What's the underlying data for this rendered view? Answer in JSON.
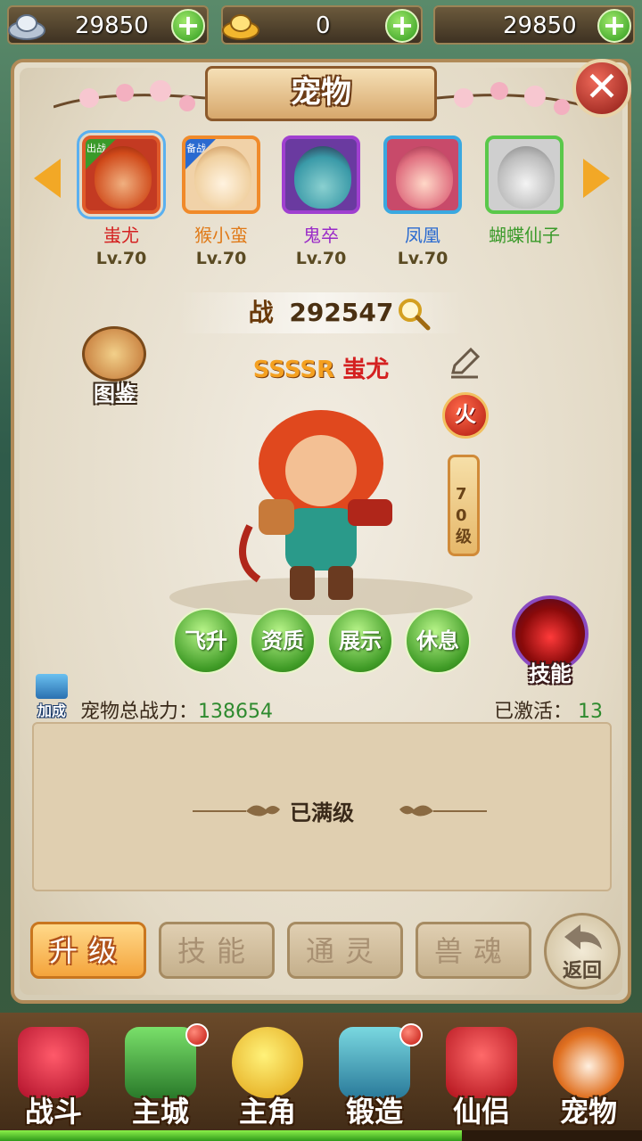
{
  "currency": [
    {
      "icon": "silver-ingot-icon",
      "value": "29850"
    },
    {
      "icon": "gold-ingot-icon",
      "value": "0"
    },
    {
      "icon": "",
      "value": "29850"
    }
  ],
  "window": {
    "title": "宠物"
  },
  "pets": [
    {
      "name": "蚩尤",
      "level": "Lv.70",
      "badge": "出战",
      "name_color": "#d42020",
      "frame_color": "#e05a2a",
      "selected": true
    },
    {
      "name": "猴小蛮",
      "level": "Lv.70",
      "badge": "备战",
      "name_color": "#e07a18",
      "frame_color": "#f08a2a"
    },
    {
      "name": "鬼卒",
      "level": "Lv.70",
      "badge": "",
      "name_color": "#9a2ac8",
      "frame_color": "#a040d0"
    },
    {
      "name": "凤凰",
      "level": "Lv.70",
      "badge": "",
      "name_color": "#2a6ad0",
      "frame_color": "#3aa8e0"
    },
    {
      "name": "蝴蝶仙子",
      "level": "",
      "badge": "",
      "name_color": "#3a9a2a",
      "frame_color": "#5ac84a"
    }
  ],
  "battle": {
    "label": "战",
    "value": "292547"
  },
  "pet_detail": {
    "rank": "SSSSR",
    "name": "蚩尤",
    "element": "火",
    "level_text": "70级",
    "codex_label": "图鉴",
    "skill_label": "技能"
  },
  "actions": [
    "飞升",
    "资质",
    "展示",
    "休息"
  ],
  "stats": {
    "bonus_label": "加成",
    "total_power_label": "宠物总战力：",
    "total_power_value": "138654",
    "activated_label": "已激活：",
    "activated_value": "13"
  },
  "info": {
    "text": "已满级"
  },
  "tabs": [
    {
      "label": "升级",
      "active": true
    },
    {
      "label": "技能",
      "active": false
    },
    {
      "label": "通灵",
      "active": false
    },
    {
      "label": "兽魂",
      "active": false
    }
  ],
  "back_label": "返回",
  "nav": [
    {
      "label": "战斗",
      "icon": "sword-icon",
      "dot": false
    },
    {
      "label": "主城",
      "icon": "city-gate-icon",
      "dot": true
    },
    {
      "label": "主角",
      "icon": "hero-face-icon",
      "dot": false
    },
    {
      "label": "锻造",
      "icon": "hammer-icon",
      "dot": true
    },
    {
      "label": "仙侣",
      "icon": "heart-flower-icon",
      "dot": false
    },
    {
      "label": "宠物",
      "icon": "monkey-pet-icon",
      "dot": false
    }
  ],
  "colors": {
    "accent": "#2e9a1e",
    "frame": "#b08a58",
    "power_value": "#2e8a2e"
  }
}
